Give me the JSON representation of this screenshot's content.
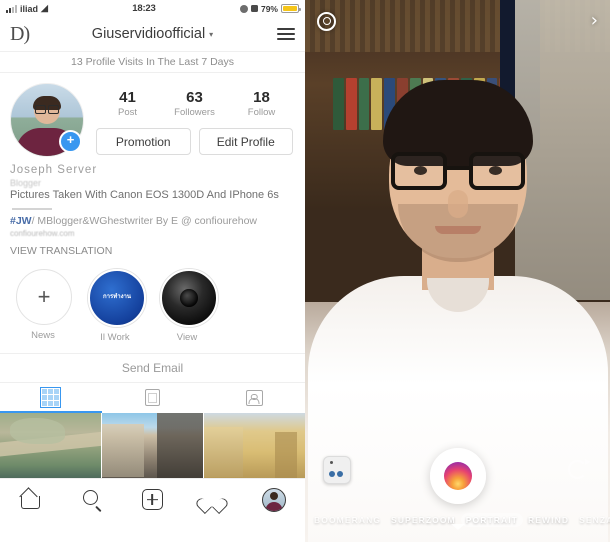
{
  "left": {
    "statusbar": {
      "carrier": "iliad",
      "wifi_icon": "wifi-icon",
      "time": "18:23",
      "location_icon": "location-icon",
      "alarm_icon": "alarm-icon",
      "battery_percent": "79%",
      "battery_icon": "battery-icon"
    },
    "header": {
      "brand_glyph": "D)",
      "title": "Giuservidioofficial",
      "title_chevron": "▾",
      "menu_icon": "hamburger-menu-icon"
    },
    "visits_banner": "13 Profile Visits In The Last 7 Days",
    "profile": {
      "avatar_icon": "profile-avatar",
      "add_story_badge": "+",
      "stats": [
        {
          "value": "41",
          "label": "Post"
        },
        {
          "value": "63",
          "label": "Followers"
        },
        {
          "value": "18",
          "label": "Follow"
        }
      ],
      "buttons": [
        {
          "label": "Promotion",
          "name": "promotion-button"
        },
        {
          "label": "Edit Profile",
          "name": "edit-profile-button"
        }
      ]
    },
    "bio": {
      "display_name": "Joseph Server",
      "category": "Blogger",
      "description": "Pictures Taken With Canon EOS 1300D And IPhone 6s",
      "tag": "#JW",
      "tagline_rest": "/ MBlogger&WGhestwriter By E @ confiourehow",
      "url": "confiourehow.com",
      "translate_label": "VIEW TRANSLATION"
    },
    "highlights": [
      {
        "caption": "News",
        "type": "new",
        "glyph": "+",
        "name": "highlight-new"
      },
      {
        "caption": "Il Work",
        "type": "cover-blue",
        "cover_text": "การทำงาน",
        "name": "highlight-work"
      },
      {
        "caption": "View",
        "type": "cover-lens",
        "name": "highlight-view"
      }
    ],
    "send_email": "Send Email",
    "tabs": [
      {
        "name": "tab-grid",
        "icon": "grid-icon",
        "active": true
      },
      {
        "name": "tab-feed",
        "icon": "feed-list-icon",
        "active": false
      },
      {
        "name": "tab-tagged",
        "icon": "tagged-person-icon",
        "active": false
      }
    ],
    "grid_photos": [
      {
        "name": "grid-photo-1",
        "alt": "rock-arch-landscape"
      },
      {
        "name": "grid-photo-2",
        "alt": "street-buildings"
      },
      {
        "name": "grid-photo-3",
        "alt": "baroque-facade"
      }
    ],
    "bottom_nav": [
      {
        "name": "nav-home",
        "icon": "home-icon"
      },
      {
        "name": "nav-search",
        "icon": "search-icon"
      },
      {
        "name": "nav-add",
        "icon": "plus-square-icon"
      },
      {
        "name": "nav-activity",
        "icon": "heart-icon"
      },
      {
        "name": "nav-profile",
        "icon": "profile-avatar-icon"
      }
    ]
  },
  "right": {
    "top": {
      "settings_icon": "camera-settings-icon",
      "forward_arrow": "›",
      "forward_icon": "chevron-right-icon"
    },
    "controls": {
      "gallery_icon": "gallery-thumbnail-icon",
      "flash_icon": "flash-icon",
      "flip_icon": "flip-camera-icon",
      "shutter_icon": "shutter-button"
    },
    "modes": [
      {
        "label": "BOOMERANG",
        "active": false
      },
      {
        "label": "SUPERZOOM",
        "active": false
      },
      {
        "label": "PORTRAIT",
        "active": true
      },
      {
        "label": "REWIND",
        "active": false
      },
      {
        "label": "SENZA TENERE",
        "active": false
      }
    ],
    "preview_alt": "front-camera-selfie-preview"
  },
  "colors": {
    "accent_blue": "#3897f0",
    "text_primary": "#3c3c3c",
    "text_muted": "#9a9a9a",
    "battery_yellow": "#f5c518"
  }
}
